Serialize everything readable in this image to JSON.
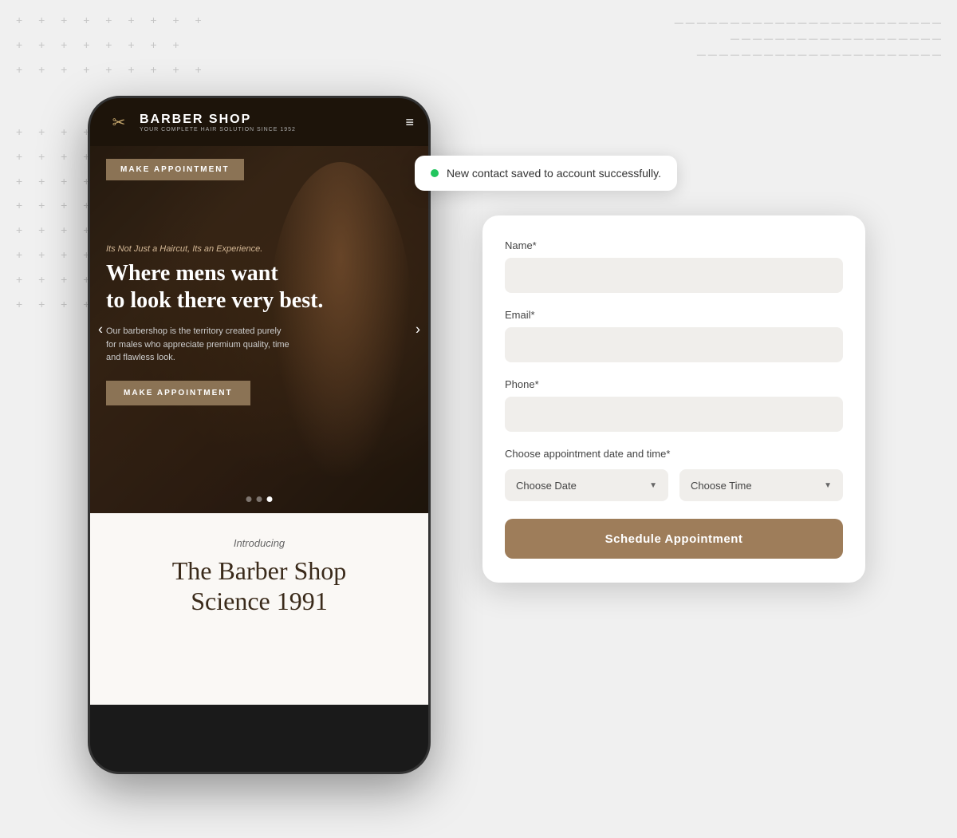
{
  "background": {
    "cross_patterns": [
      "+ + + + + + +",
      "+ + + + +",
      "+ + + + + +"
    ],
    "dash_lines": [
      "— — — — — — — — — — — — — — — — — — — — —",
      "— — — — — — — — — — — — — — — —",
      "— — — — — — — — — — — — — — — — — — — — — —"
    ]
  },
  "phone": {
    "logo": {
      "title": "BARBER SHOP",
      "subtitle": "YOUR COMPLETE HAIR SOLUTION SINCE 1952",
      "icon": "✂"
    },
    "hero": {
      "make_appointment_top": "MAKE APPOINTMENT",
      "tagline": "Its Not Just a Haircut, Its an Experience.",
      "headline": "Where mens want\nto look there very best.",
      "description": "Our barbershop is the territory created purely for males who appreciate premium quality, time and flawless look.",
      "make_appointment_bottom": "MAKE APPOINTMENT",
      "carousel_dots": [
        false,
        false,
        true
      ],
      "nav_left": "‹",
      "nav_right": "›"
    },
    "bottom": {
      "introducing": "Introducing",
      "name_line1": "The Barber Shop",
      "name_line2": "Science 1991"
    }
  },
  "toast": {
    "dot_color": "#22c55e",
    "message": "New contact saved to account successfully."
  },
  "form": {
    "fields": [
      {
        "label": "Name*",
        "placeholder": "",
        "id": "name"
      },
      {
        "label": "Email*",
        "placeholder": "",
        "id": "email"
      },
      {
        "label": "Phone*",
        "placeholder": "",
        "id": "phone"
      }
    ],
    "datetime_label": "Choose appointment date and time*",
    "choose_date": "Choose Date",
    "choose_time": "Choose Time",
    "dropdown_arrow": "▼",
    "submit_button": "Schedule Appointment"
  }
}
